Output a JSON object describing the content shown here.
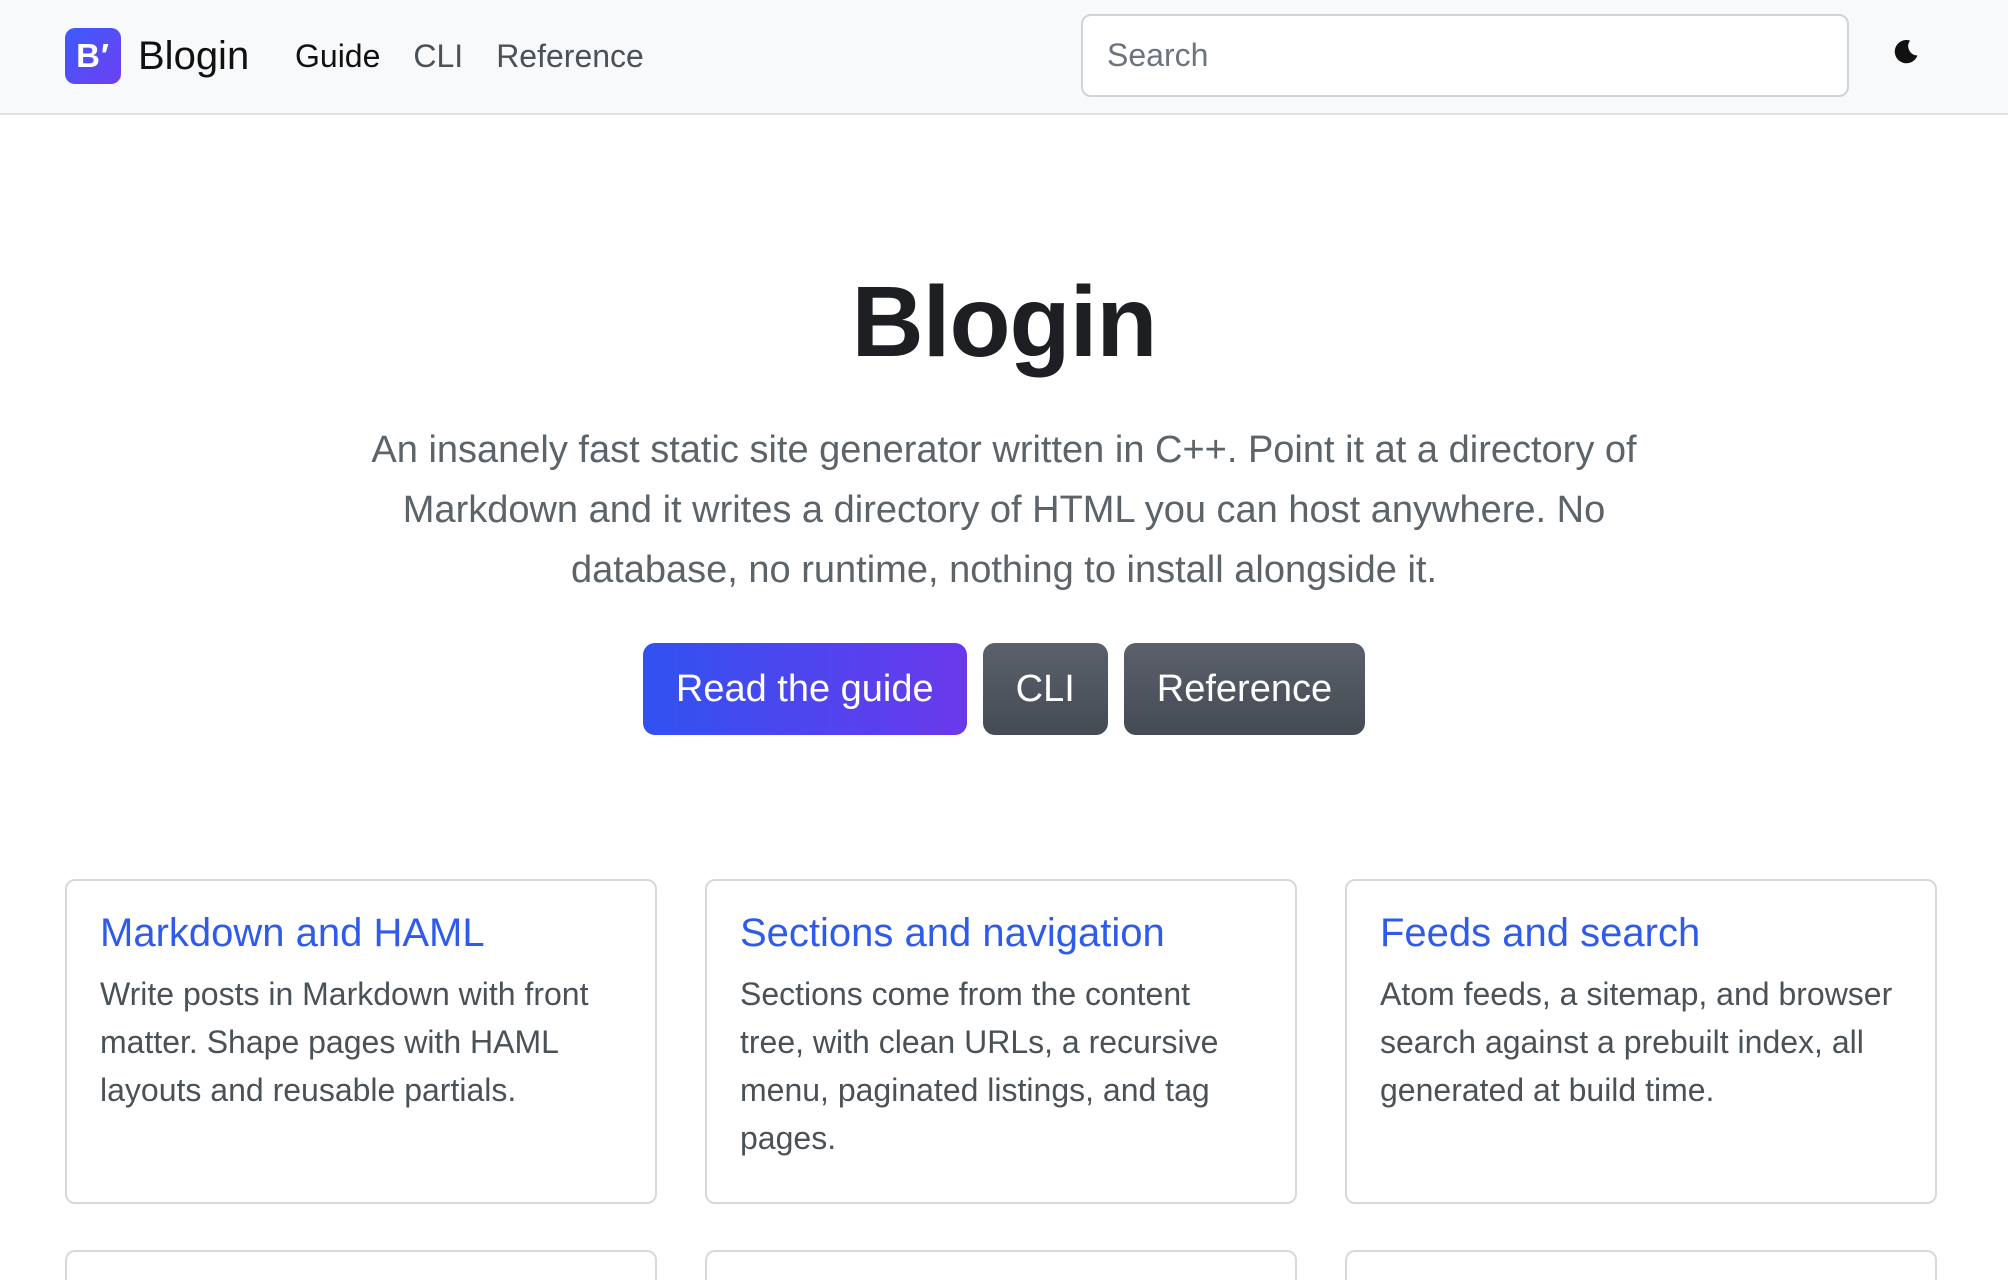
{
  "navbar": {
    "logo_text": "B′",
    "brand_name": "Blogin",
    "links": [
      {
        "label": "Guide",
        "active": true
      },
      {
        "label": "CLI",
        "active": false
      },
      {
        "label": "Reference",
        "active": false
      }
    ],
    "search_placeholder": "Search",
    "theme_icon": "moon-icon"
  },
  "hero": {
    "title": "Blogin",
    "lead": "An insanely fast static site generator written in C++. Point it at a directory of Markdown and it writes a directory of HTML you can host anywhere. No database, no runtime, nothing to install alongside it.",
    "buttons": {
      "guide": "Read the guide",
      "cli": "CLI",
      "reference": "Reference"
    }
  },
  "features": [
    {
      "title": "Markdown and HAML",
      "text": "Write posts in Markdown with front matter. Shape pages with HAML layouts and reusable partials."
    },
    {
      "title": "Sections and navigation",
      "text": "Sections come from the content tree, with clean URLs, a recursive menu, paginated listings, and tag pages."
    },
    {
      "title": "Feeds and search",
      "text": "Atom feeds, a sitemap, and browser search against a prebuilt index, all generated at build time."
    }
  ],
  "colors": {
    "accent": "#2f5bea",
    "primary_gradient_start": "#3152f0",
    "primary_gradient_end": "#6a39ec",
    "secondary": "#4f555e"
  }
}
